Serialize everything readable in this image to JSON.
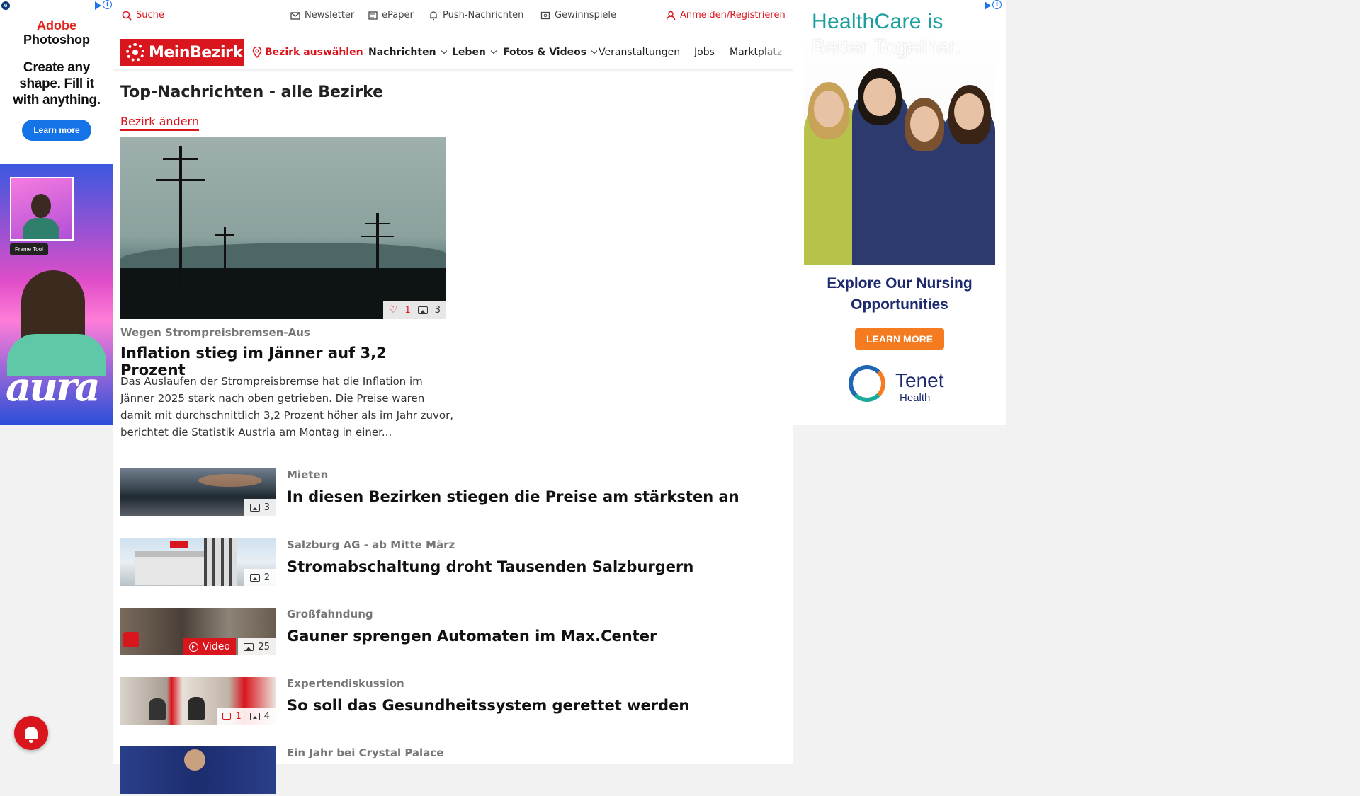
{
  "utility": {
    "search": "Suche",
    "newsletter": "Newsletter",
    "epaper": "ePaper",
    "push": "Push-Nachrichten",
    "contests": "Gewinnspiele",
    "login": "Anmelden/Registrieren"
  },
  "nav": {
    "logo": "MeinBezirk",
    "district": "Bezirk auswählen",
    "items": [
      "Nachrichten",
      "Leben",
      "Fotos & Videos",
      "Veranstaltungen",
      "Jobs",
      "Marktplatz"
    ]
  },
  "page": {
    "title": "Top-Nachrichten - alle Bezirke",
    "change_district": "Bezirk ändern"
  },
  "lead": {
    "kicker": "Wegen Strompreisbremsen-Aus",
    "title": "Inflation stieg im Jänner auf 3,2 Prozent",
    "teaser": "Das Auslaufen der Strompreisbremse hat die Inflation im Jänner 2025 stark nach oben getrieben. Die Preise waren damit mit durchschnittlich 3,2 Prozent höher als im Jahr zuvor, berichtet die Statistik Austria am Montag in einer...",
    "likes": "1",
    "photos": "3"
  },
  "articles": [
    {
      "kicker": "Mieten",
      "title": "In diesen Bezirken stiegen die Preise am stärksten an",
      "photos": "3"
    },
    {
      "kicker": "Salzburg AG - ab Mitte März",
      "title": "Stromabschaltung droht Tausenden Salzburgern",
      "photos": "2"
    },
    {
      "kicker": "Großfahndung",
      "title": "Gauner sprengen Automaten im Max.Center",
      "video": "Video",
      "photos": "25"
    },
    {
      "kicker": "Expertendiskussion",
      "title": "So soll das Gesundheitssystem gerettet werden",
      "comments": "1",
      "photos": "4"
    },
    {
      "kicker": "Ein Jahr bei Crystal Palace",
      "title": ""
    }
  ],
  "ad_left": {
    "brand_top": "Adobe",
    "brand_name": "Photoshop",
    "tagline": "Create any shape. Fill it with anything.",
    "cta": "Learn more",
    "frame_tool": "Frame Tool",
    "art_text": "aura"
  },
  "ad_right": {
    "headline_1": "HealthCare is",
    "headline_2": "Better Together.",
    "sub": "Explore Our Nursing Opportunities",
    "cta": "LEARN MORE",
    "brand": "Tenet",
    "brand_sub": "Health"
  },
  "colors": {
    "brand_red": "#d9161e",
    "kicker_gray": "#777777",
    "healthcare_teal": "#1b9e9e",
    "healthcare_navy": "#1d2a6e",
    "cta_orange": "#f47b20"
  }
}
